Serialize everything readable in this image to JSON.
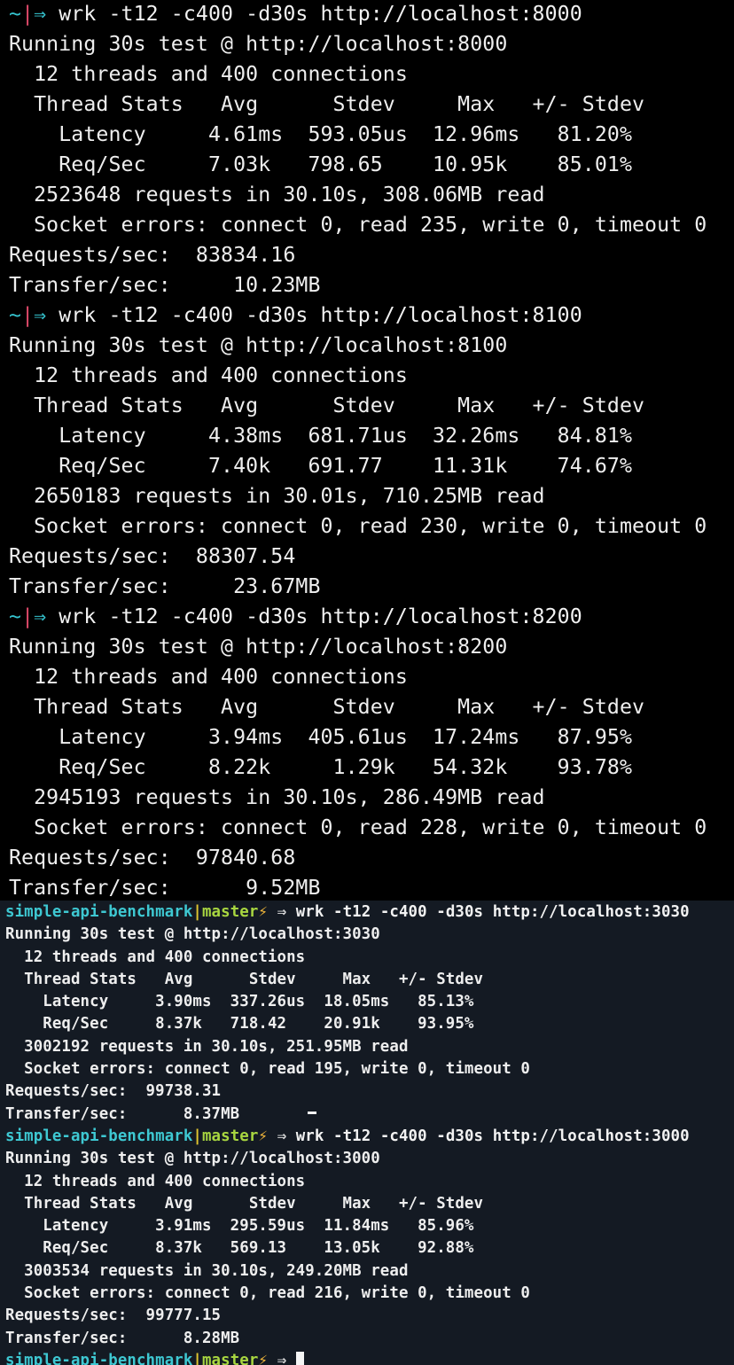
{
  "top_pane": {
    "prompt_tilde": "~",
    "prompt_bar": "|",
    "prompt_arrow": "⇒",
    "runs": [
      {
        "command": "wrk -t12 -c400 -d30s http://localhost:8000",
        "lines": [
          "Running 30s test @ http://localhost:8000",
          "  12 threads and 400 connections",
          "  Thread Stats   Avg      Stdev     Max   +/- Stdev",
          "    Latency     4.61ms  593.05us  12.96ms   81.20%",
          "    Req/Sec     7.03k   798.65    10.95k    85.01%",
          "  2523648 requests in 30.10s, 308.06MB read",
          "  Socket errors: connect 0, read 235, write 0, timeout 0",
          "Requests/sec:  83834.16",
          "Transfer/sec:     10.23MB"
        ]
      },
      {
        "command": "wrk -t12 -c400 -d30s http://localhost:8100",
        "lines": [
          "Running 30s test @ http://localhost:8100",
          "  12 threads and 400 connections",
          "  Thread Stats   Avg      Stdev     Max   +/- Stdev",
          "    Latency     4.38ms  681.71us  32.26ms   84.81%",
          "    Req/Sec     7.40k   691.77    11.31k    74.67%",
          "  2650183 requests in 30.01s, 710.25MB read",
          "  Socket errors: connect 0, read 230, write 0, timeout 0",
          "Requests/sec:  88307.54",
          "Transfer/sec:     23.67MB"
        ]
      },
      {
        "command": "wrk -t12 -c400 -d30s http://localhost:8200",
        "lines": [
          "Running 30s test @ http://localhost:8200",
          "  12 threads and 400 connections",
          "  Thread Stats   Avg      Stdev     Max   +/- Stdev",
          "    Latency     3.94ms  405.61us  17.24ms   87.95%",
          "    Req/Sec     8.22k     1.29k   54.32k    93.78%",
          "  2945193 requests in 30.10s, 286.49MB read",
          "  Socket errors: connect 0, read 228, write 0, timeout 0",
          "Requests/sec:  97840.68",
          "Transfer/sec:      9.52MB"
        ]
      }
    ]
  },
  "bottom_pane": {
    "prompt_dir": "simple-api-benchmark",
    "prompt_sep": "|",
    "prompt_branch": "master",
    "prompt_bolt": "⚡",
    "prompt_arrow": "⇒",
    "runs": [
      {
        "command": "wrk -t12 -c400 -d30s http://localhost:3030",
        "lines": [
          "Running 30s test @ http://localhost:3030",
          "  12 threads and 400 connections",
          "  Thread Stats   Avg      Stdev     Max   +/- Stdev",
          "    Latency     3.90ms  337.26us  18.05ms   85.13%",
          "    Req/Sec     8.37k   718.42    20.91k    93.95%",
          "  3002192 requests in 30.10s, 251.95MB read",
          "  Socket errors: connect 0, read 195, write 0, timeout 0",
          "Requests/sec:  99738.31",
          "Transfer/sec:      8.37MB"
        ]
      },
      {
        "command": "wrk -t12 -c400 -d30s http://localhost:3000",
        "lines": [
          "Running 30s test @ http://localhost:3000",
          "  12 threads and 400 connections",
          "  Thread Stats   Avg      Stdev     Max   +/- Stdev",
          "    Latency     3.91ms  295.59us  11.84ms   85.96%",
          "    Req/Sec     8.37k   569.13    13.05k    92.88%",
          "  3003534 requests in 30.10s, 249.20MB read",
          "  Socket errors: connect 0, read 216, write 0, timeout 0",
          "Requests/sec:  99777.15",
          "Transfer/sec:      8.28MB"
        ]
      }
    ]
  },
  "colors": {
    "top_background": "#000000",
    "bottom_background": "#141a23",
    "text": "#eeeeee",
    "prompt_cyan": "#35c4cf",
    "prompt_pink": "#e04a6a",
    "branch_green": "#a8d640",
    "separator_yellow": "#e0c52f",
    "bolt_orange": "#f1b63a"
  }
}
